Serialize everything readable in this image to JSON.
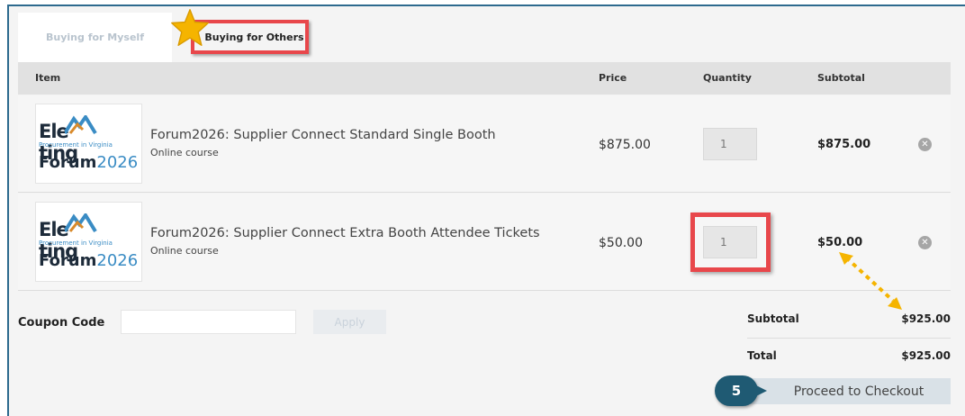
{
  "tabs": {
    "myself": "Buying for Myself",
    "others": "Buying for Others"
  },
  "table": {
    "headers": {
      "item": "Item",
      "price": "Price",
      "quantity": "Quantity",
      "subtotal": "Subtotal"
    },
    "rows": [
      {
        "logo_line1": "Ele",
        "logo_line1b": "ting",
        "logo_line2": "Procurement in Virginia",
        "logo_line3a": "Forum",
        "logo_line3b": "2026",
        "title": "Forum2026: Supplier Connect Standard Single Booth",
        "subtitle": "Online course",
        "price": "$875.00",
        "quantity": "1",
        "subtotal": "$875.00"
      },
      {
        "logo_line1": "Ele",
        "logo_line1b": "ting",
        "logo_line2": "Procurement in Virginia",
        "logo_line3a": "Forum",
        "logo_line3b": "2026",
        "title": "Forum2026: Supplier Connect Extra Booth Attendee Tickets",
        "subtitle": "Online course",
        "price": "$50.00",
        "quantity": "1",
        "subtotal": "$50.00"
      }
    ]
  },
  "coupon": {
    "label": "Coupon Code",
    "placeholder": "",
    "apply": "Apply"
  },
  "summary": {
    "subtotal_label": "Subtotal",
    "subtotal_value": "$925.00",
    "total_label": "Total",
    "total_value": "$925.00"
  },
  "checkout": {
    "step": "5",
    "label": "Proceed to Checkout"
  },
  "colors": {
    "highlight": "#e8474b",
    "accent": "#1f5a73",
    "star": "#f5b400"
  },
  "icons": [
    "star-icon",
    "remove-icon",
    "arrow-icon"
  ]
}
